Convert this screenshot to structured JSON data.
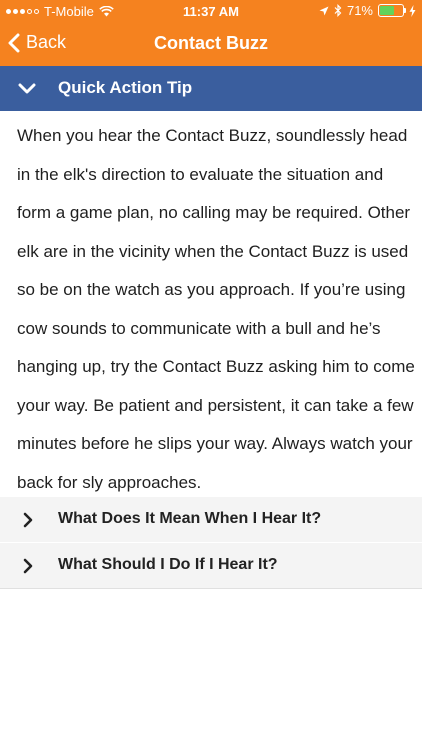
{
  "status_bar": {
    "carrier": "T-Mobile",
    "time": "11:37 AM",
    "battery_percent": "71%",
    "battery_level": 0.71,
    "battery_color": "#63d35b"
  },
  "nav": {
    "back_label": "Back",
    "title": "Contact Buzz",
    "bar_color": "#f5821f"
  },
  "tip_section": {
    "title": "Quick Action Tip",
    "expanded": true,
    "header_color": "#3a5e9e",
    "body": "When you hear the Contact Buzz, soundlessly head in the elk's direction to evaluate the situation and form a game plan, no calling may be required. Other elk are in the vicinity when the Contact Buzz is used so be on the watch as you approach. If you’re using cow sounds to communicate with a bull and he’s hanging up, try the Contact Buzz asking him to come your way. Be patient and persistent, it can take a few minutes before he slips your way. Always watch your back for sly approaches."
  },
  "sections": [
    {
      "title": "What Does It Mean When I Hear It?",
      "expanded": false
    },
    {
      "title": "What Should I Do If I Hear It?",
      "expanded": false
    }
  ]
}
